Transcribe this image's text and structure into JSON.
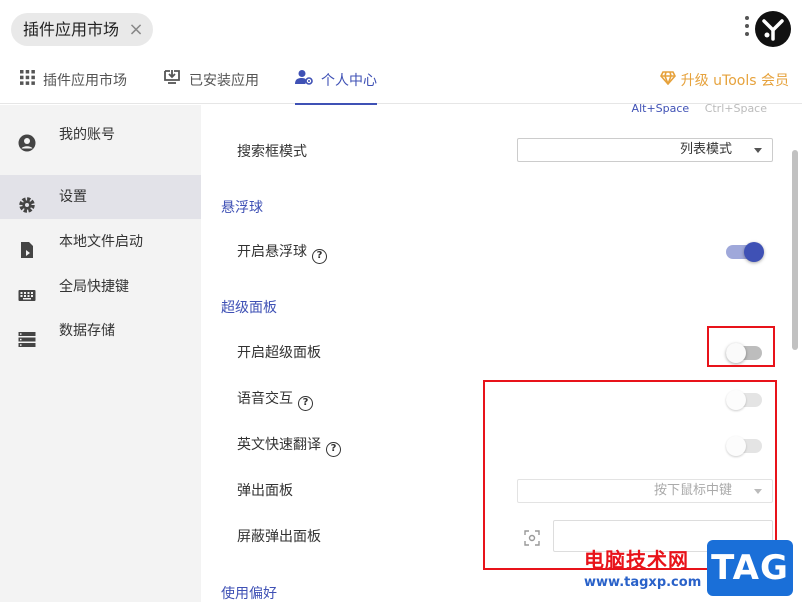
{
  "topbar": {
    "search_chip_label": "插件应用市场",
    "close_glyph": "×"
  },
  "tabs": [
    {
      "label": "插件应用市场",
      "icon": "grid-icon"
    },
    {
      "label": "已安装应用",
      "icon": "installed-icon"
    },
    {
      "label": "个人中心",
      "icon": "user-gear-icon",
      "active": true
    }
  ],
  "upgrade_label": "升级 uTools 会员",
  "sidebar": {
    "items": [
      {
        "label": "我的账号",
        "icon": "account-icon"
      },
      {
        "label": "设置",
        "icon": "gear-icon",
        "active": true
      },
      {
        "label": "本地文件启动",
        "icon": "file-launch-icon"
      },
      {
        "label": "全局快捷键",
        "icon": "keyboard-icon"
      },
      {
        "label": "数据存储",
        "icon": "storage-icon"
      }
    ]
  },
  "main": {
    "hint_active": "Alt+Space",
    "hint_inactive": "Ctrl+Space",
    "search_mode_label": "搜索框模式",
    "search_mode_value": "列表模式",
    "float_section": "悬浮球",
    "float_enable_label": "开启悬浮球",
    "super_section": "超级面板",
    "super_enable_label": "开启超级面板",
    "voice_label": "语音交互",
    "translate_label": "英文快速翻译",
    "popup_label": "弹出面板",
    "popup_value": "按下鼠标中键",
    "block_popup_label": "屏蔽弹出面板",
    "prefs_section": "使用偏好",
    "help_glyph": "?"
  },
  "toggles": {
    "float_enable": true,
    "super_enable": false,
    "voice": false,
    "translate": false
  },
  "colors": {
    "accent": "#3f51b5",
    "upgrade": "#e6a23c",
    "annotation": "#e8131a"
  },
  "watermark": {
    "title": "电脑技术网",
    "url": "www.tagxp.com",
    "tag": "TAG"
  }
}
